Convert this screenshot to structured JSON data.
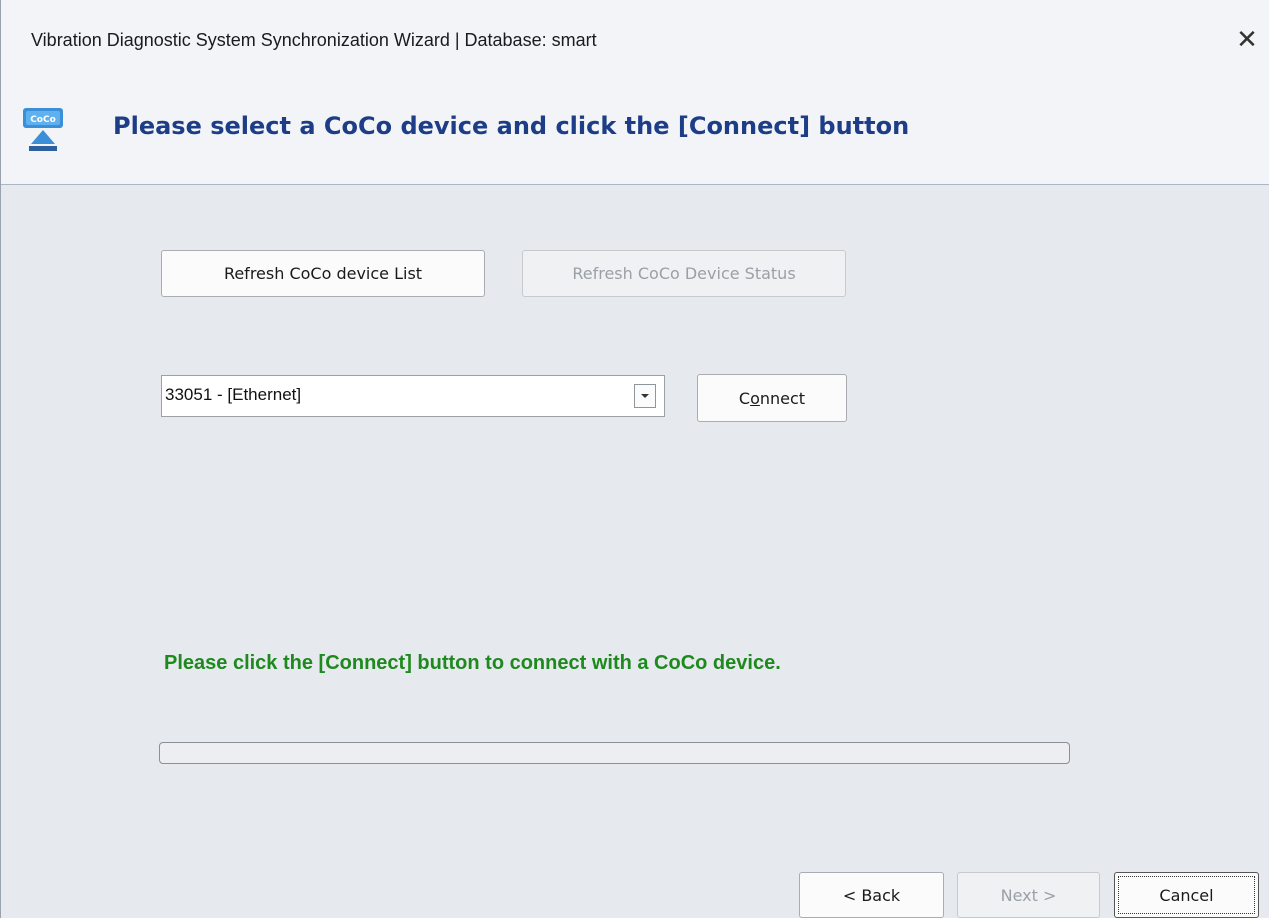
{
  "window": {
    "title": "Vibration Diagnostic System Synchronization Wizard | Database: smart",
    "close_icon": "close-icon"
  },
  "header": {
    "icon": "coco-device-icon",
    "title": "Please select a CoCo device and click the [Connect] button"
  },
  "toolbar": {
    "refresh_list_label": "Refresh CoCo device List",
    "refresh_status_label": "Refresh CoCo Device Status"
  },
  "device": {
    "selected": "33051 - [Ethernet]",
    "connect_label_pre": "C",
    "connect_label_mnemonic": "o",
    "connect_label_post": "nnect"
  },
  "status": {
    "message": "Please click the [Connect] button to connect with a CoCo device.",
    "progress_fraction": 0
  },
  "footer": {
    "back_label": "< Back",
    "next_label": "Next >",
    "cancel_label": "Cancel"
  },
  "colors": {
    "header_title": "#1d3d86",
    "status_message": "#1e8a1e"
  }
}
